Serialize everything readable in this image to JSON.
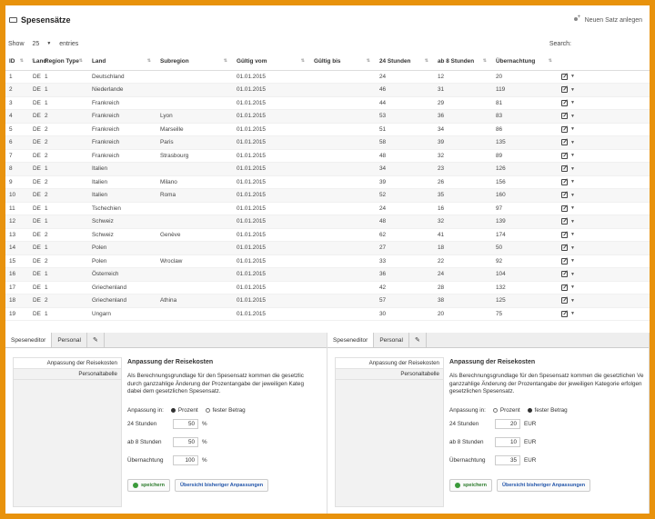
{
  "header": {
    "title": "Spesensätze",
    "new_button": "Neuen Satz anlegen"
  },
  "controls": {
    "show_label": "Show",
    "entries_value": "25",
    "entries_label": "entries",
    "search_label": "Search:"
  },
  "table": {
    "columns": [
      "ID",
      "Land",
      "Region Type",
      "Land",
      "Subregion",
      "Gültig vom",
      "Gültig bis",
      "24 Stunden",
      "ab 8 Stunden",
      "Übernachtung"
    ],
    "rows": [
      [
        "1",
        "DE",
        "1",
        "Deutschland",
        "",
        "01.01.2015",
        "",
        "24",
        "12",
        "20"
      ],
      [
        "2",
        "DE",
        "1",
        "Niederlande",
        "",
        "01.01.2015",
        "",
        "46",
        "31",
        "119"
      ],
      [
        "3",
        "DE",
        "1",
        "Frankreich",
        "",
        "01.01.2015",
        "",
        "44",
        "29",
        "81"
      ],
      [
        "4",
        "DE",
        "2",
        "Frankreich",
        "Lyon",
        "01.01.2015",
        "",
        "53",
        "36",
        "83"
      ],
      [
        "5",
        "DE",
        "2",
        "Frankreich",
        "Marseille",
        "01.01.2015",
        "",
        "51",
        "34",
        "86"
      ],
      [
        "6",
        "DE",
        "2",
        "Frankreich",
        "Paris",
        "01.01.2015",
        "",
        "58",
        "39",
        "135"
      ],
      [
        "7",
        "DE",
        "2",
        "Frankreich",
        "Strasbourg",
        "01.01.2015",
        "",
        "48",
        "32",
        "89"
      ],
      [
        "8",
        "DE",
        "1",
        "Italien",
        "",
        "01.01.2015",
        "",
        "34",
        "23",
        "126"
      ],
      [
        "9",
        "DE",
        "2",
        "Italien",
        "Milano",
        "01.01.2015",
        "",
        "39",
        "26",
        "156"
      ],
      [
        "10",
        "DE",
        "2",
        "Italien",
        "Roma",
        "01.01.2015",
        "",
        "52",
        "35",
        "160"
      ],
      [
        "11",
        "DE",
        "1",
        "Tschechien",
        "",
        "01.01.2015",
        "",
        "24",
        "16",
        "97"
      ],
      [
        "12",
        "DE",
        "1",
        "Schweiz",
        "",
        "01.01.2015",
        "",
        "48",
        "32",
        "139"
      ],
      [
        "13",
        "DE",
        "2",
        "Schweiz",
        "Genève",
        "01.01.2015",
        "",
        "62",
        "41",
        "174"
      ],
      [
        "14",
        "DE",
        "1",
        "Polen",
        "",
        "01.01.2015",
        "",
        "27",
        "18",
        "50"
      ],
      [
        "15",
        "DE",
        "2",
        "Polen",
        "Wroclaw",
        "01.01.2015",
        "",
        "33",
        "22",
        "92"
      ],
      [
        "16",
        "DE",
        "1",
        "Österreich",
        "",
        "01.01.2015",
        "",
        "36",
        "24",
        "104"
      ],
      [
        "17",
        "DE",
        "1",
        "Griechenland",
        "",
        "01.01.2015",
        "",
        "42",
        "28",
        "132"
      ],
      [
        "18",
        "DE",
        "2",
        "Griechenland",
        "Athina",
        "01.01.2015",
        "",
        "57",
        "38",
        "125"
      ],
      [
        "19",
        "DE",
        "1",
        "Ungarn",
        "",
        "01.01.2015",
        "",
        "30",
        "20",
        "75"
      ]
    ]
  },
  "panels": [
    {
      "tabs": [
        "Speseneditor",
        "Personal"
      ],
      "side_items": [
        "Anpassung der Reisekosten",
        "Personaltabelle"
      ],
      "heading": "Anpassung der Reisekosten",
      "desc": [
        "Als Berechnungsgrundlage für den Spesensatz kommen die gesetzlic",
        "durch ganzzahlige Änderung der Prozentangabe der jeweiligen Kateg",
        "dabei dem gesetzlichen Spesensatz."
      ],
      "mode_label": "Anpassung in:",
      "opt_percent": "Prozent",
      "opt_fixed": "fester Betrag",
      "fields": [
        {
          "label": "24 Stunden",
          "value": "50",
          "unit": "%"
        },
        {
          "label": "ab 8 Stunden",
          "value": "50",
          "unit": "%"
        },
        {
          "label": "Übernachtung",
          "value": "100",
          "unit": "%"
        }
      ],
      "save": "speichern",
      "overview": "Übersicht bisheriger Anpassungen"
    },
    {
      "tabs": [
        "Speseneditor",
        "Personal"
      ],
      "side_items": [
        "Anpassung der Reisekosten",
        "Personaltabelle"
      ],
      "heading": "Anpassung der Reisekosten",
      "desc": [
        "Als Berechnungsgrundlage für den Spesensatz kommen die gesetzlichen Ve",
        "ganzzahlige Änderung der Prozentangabe der jeweiligen Kategorie erfolgen",
        "gesetzlichen Spesensatz."
      ],
      "mode_label": "Anpassung in:",
      "opt_percent": "Prozent",
      "opt_fixed": "fester Betrag",
      "fields": [
        {
          "label": "24 Stunden",
          "value": "20",
          "unit": "EUR"
        },
        {
          "label": "ab 8 Stunden",
          "value": "10",
          "unit": "EUR"
        },
        {
          "label": "Übernachtung",
          "value": "35",
          "unit": "EUR"
        }
      ],
      "save": "speichern",
      "overview": "Übersicht bisheriger Anpassungen"
    }
  ],
  "colors": {
    "frame": "#e8920c",
    "save": "#2a7a2a",
    "link": "#2255aa"
  }
}
